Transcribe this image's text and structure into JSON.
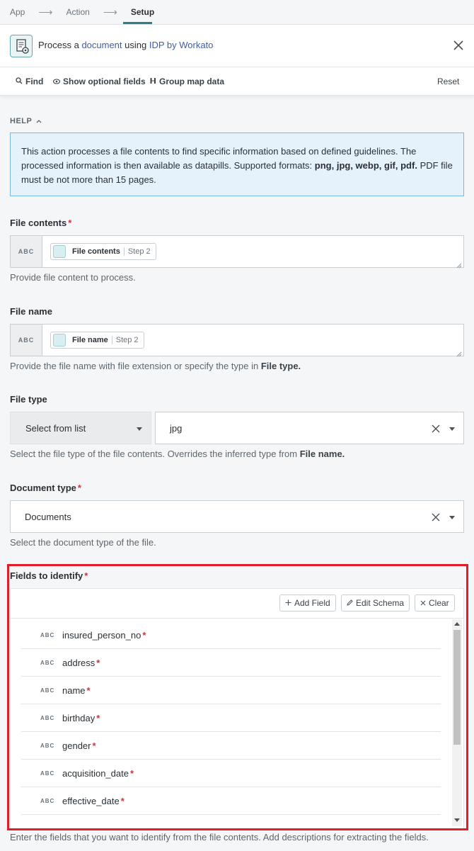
{
  "breadcrumb": {
    "items": [
      "App",
      "Action",
      "Setup"
    ],
    "arrow": "⟶"
  },
  "header": {
    "prefix": "Process a",
    "link1": "document",
    "middle": "using",
    "link2": "IDP by Workato"
  },
  "toolbar": {
    "find": "Find",
    "show_optional": "Show optional fields",
    "group_map": "Group map data",
    "reset": "Reset"
  },
  "help": {
    "label": "HELP",
    "text_plain": "This action processes a file contents to find specific information based on defined guidelines. The processed information is then available as datapills. Supported formats:",
    "formats": "png, jpg, webp, gif, pdf.",
    "text_tail": "PDF file must be not more than 15 pages."
  },
  "file_contents": {
    "label": "File contents",
    "required_mark": "*",
    "type_badge": "ABC",
    "pill_name": "File contents",
    "pill_step": "Step 2",
    "hint": "Provide file content to process."
  },
  "file_name": {
    "label": "File name",
    "type_badge": "ABC",
    "pill_name": "File name",
    "pill_step": "Step 2",
    "hint_plain": "Provide the file name with file extension or specify the type in",
    "hint_bold": "File type."
  },
  "file_type": {
    "label": "File type",
    "mode": "Select from list",
    "value": "jpg",
    "hint_plain": "Select the file type of the file contents. Overrides the inferred type from",
    "hint_bold": "File name."
  },
  "document_type": {
    "label": "Document type",
    "required_mark": "*",
    "value": "Documents",
    "hint": "Select the document type of the file."
  },
  "fields_to_identify": {
    "label": "Fields to identify",
    "required_mark": "*",
    "buttons": {
      "add": "Add Field",
      "edit": "Edit Schema",
      "clear": "Clear"
    },
    "type_badge": "ABC",
    "fields": [
      {
        "name": "insured_person_no",
        "required": "*"
      },
      {
        "name": "address",
        "required": "*"
      },
      {
        "name": "name",
        "required": "*"
      },
      {
        "name": "birthday",
        "required": "*"
      },
      {
        "name": "gender",
        "required": "*"
      },
      {
        "name": "acquisition_date",
        "required": "*"
      },
      {
        "name": "effective_date",
        "required": "*"
      }
    ],
    "hint": "Enter the fields that you want to identify from the file contents. Add descriptions for extracting the fields."
  },
  "colors": {
    "accent": "#2e7d86",
    "link": "#3e5fa8",
    "required": "#d0333b",
    "highlight_frame": "#e21d2b",
    "help_bg": "#e6f2fb",
    "help_border": "#7cb7e4"
  },
  "icons": [
    "arrow-right-icon",
    "document-gear-icon",
    "close-icon",
    "search-icon",
    "eye-icon",
    "group-icon",
    "chevron-up-icon",
    "datapill-icon",
    "caret-down-icon",
    "clear-x-icon",
    "plus-icon",
    "pencil-icon",
    "resize-handle-icon"
  ]
}
